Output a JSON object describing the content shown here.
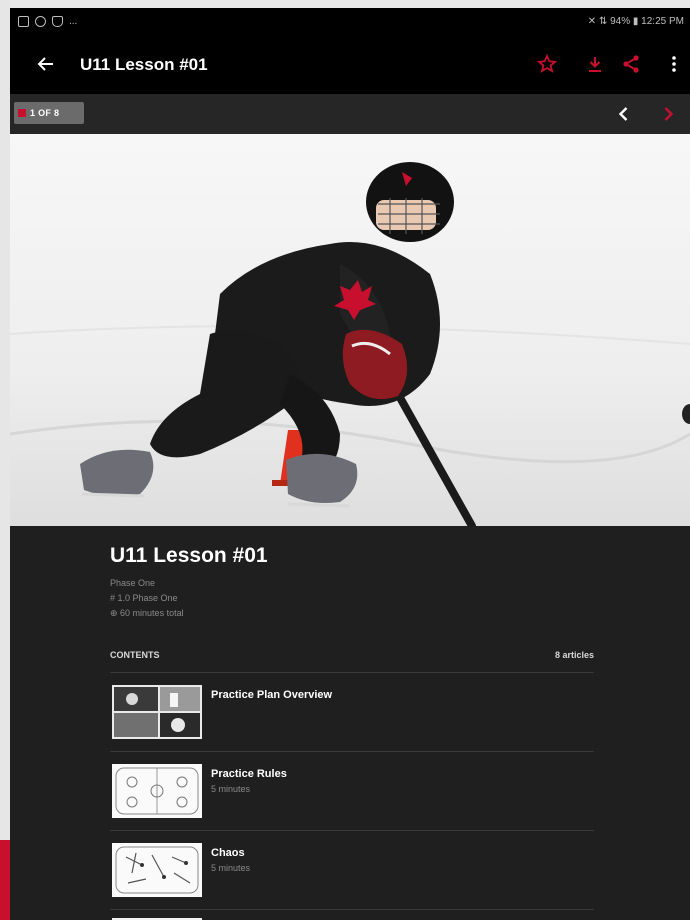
{
  "status_bar": {
    "left_icons": [
      "image-icon",
      "clock-icon",
      "shield-icon"
    ],
    "left_extra": "...",
    "right_text": "✕ ⇅ 94% ▮ 12:25 PM"
  },
  "app_bar": {
    "title": "U11 Lesson #01",
    "icons": [
      "back-arrow-icon",
      "star-icon",
      "download-icon",
      "share-icon",
      "more-vert-icon"
    ]
  },
  "pager": {
    "label": "1 OF 8"
  },
  "lesson": {
    "title": "U11 Lesson #01",
    "phase": "Phase One",
    "version": "# 1.0 Phase One",
    "duration": "⊕ 60 minutes total"
  },
  "contents": {
    "header": "CONTENTS",
    "count": "8 articles",
    "items": [
      {
        "title": "Practice Plan Overview",
        "subtitle": ""
      },
      {
        "title": "Practice Rules",
        "subtitle": "5 minutes"
      },
      {
        "title": "Chaos",
        "subtitle": "5 minutes"
      }
    ]
  },
  "colors": {
    "accent": "#c8102e",
    "background": "#1f1f1f",
    "toolbar": "#000000"
  }
}
